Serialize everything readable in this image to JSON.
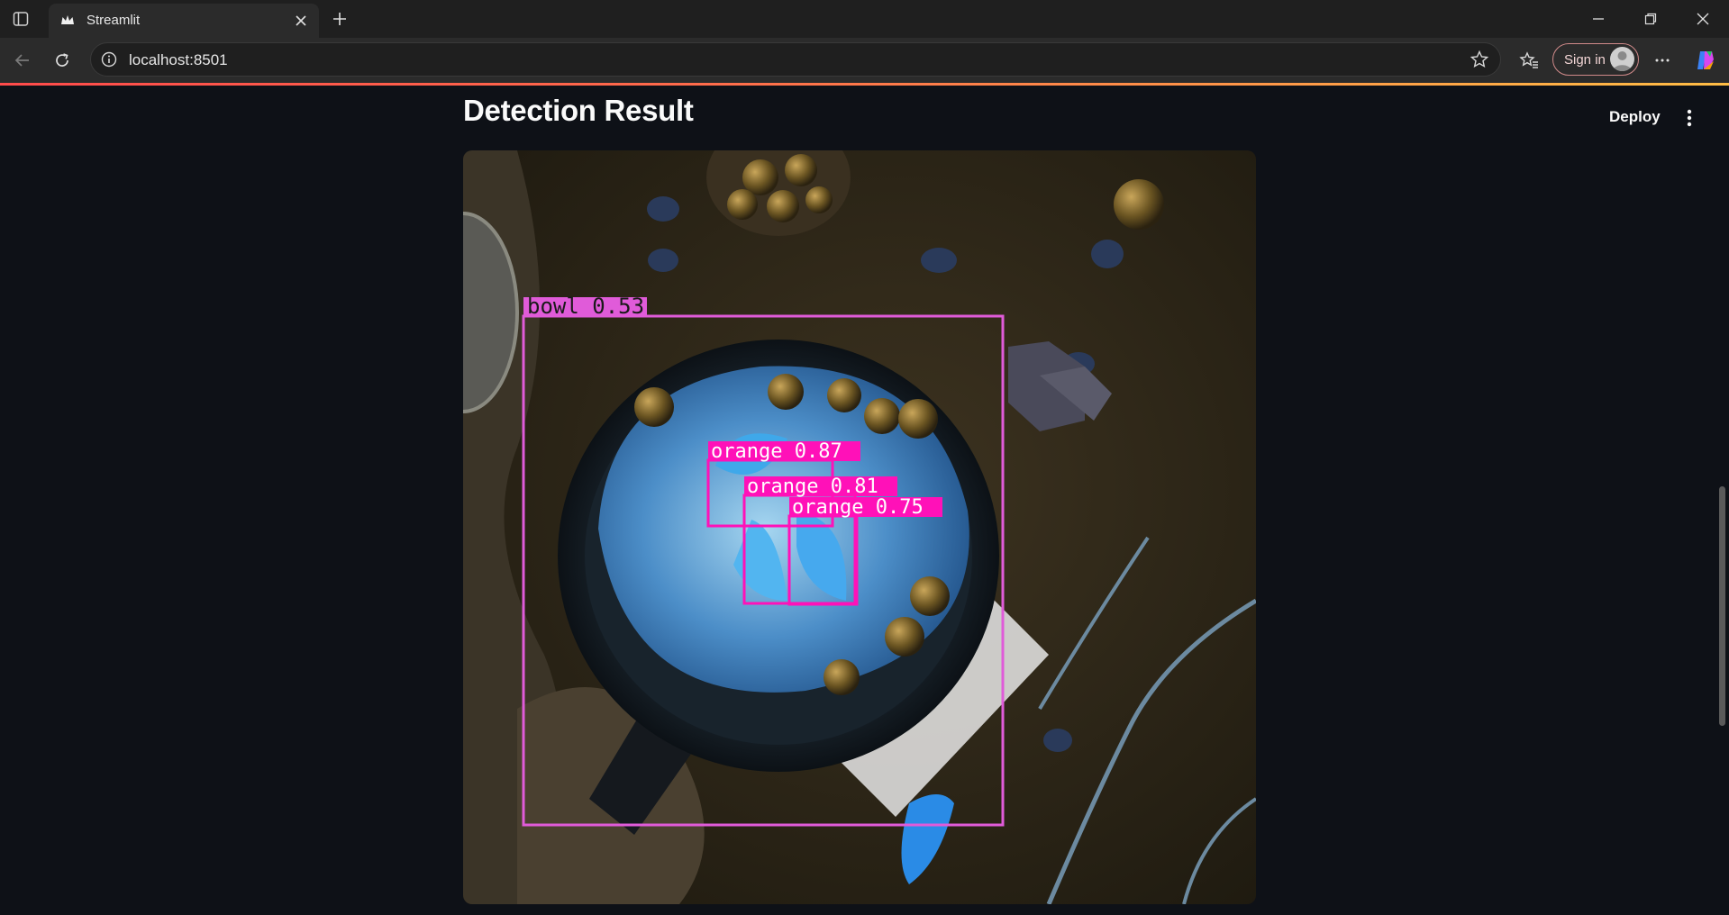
{
  "browser": {
    "tab": {
      "title": "Streamlit",
      "favicon": "streamlit-crown-icon"
    },
    "address": {
      "url": "localhost:8501"
    },
    "signin_label": "Sign in",
    "icons": [
      "tab-actions-icon",
      "close-icon",
      "plus-icon",
      "minimize-icon",
      "restore-icon",
      "window-close-icon",
      "back-icon",
      "reload-icon",
      "info-icon",
      "star-icon",
      "favorites-icon",
      "more-icon",
      "copilot-icon"
    ]
  },
  "app": {
    "title": "Detection Result",
    "deploy_label": "Deploy",
    "menu_icon": "vertical-ellipsis-icon",
    "accent_gradient": [
      "#ff4b4b",
      "#ffbd45"
    ],
    "background": "#0e1117"
  },
  "detections": [
    {
      "label": "bowl 0.53",
      "color": "#e05bd9"
    },
    {
      "label": "orange 0.87",
      "color": "#ff11b8"
    },
    {
      "label": "orange 0.81",
      "color": "#ff11b8"
    },
    {
      "label": "orange 0.75",
      "color": "#ff11b8"
    }
  ]
}
